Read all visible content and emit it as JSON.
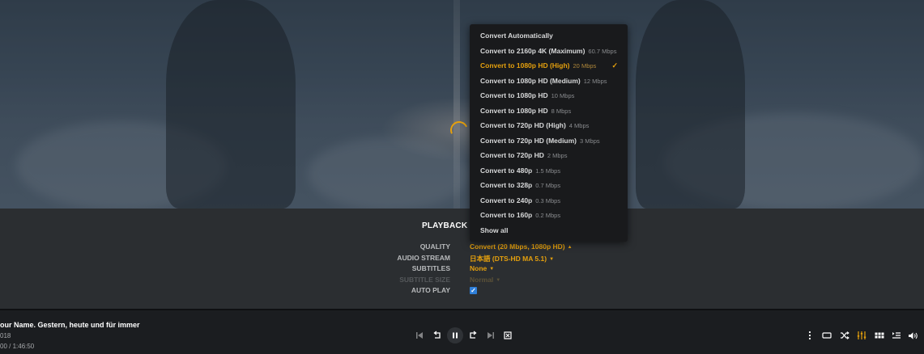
{
  "settings": {
    "title": "PLAYBACK SE",
    "rows": [
      {
        "label": "QUALITY",
        "value": "Convert (20 Mbps, 1080p HD)",
        "caret": "▲"
      },
      {
        "label": "AUDIO STREAM",
        "value": "日本語 (DTS-HD MA 5.1)",
        "caret": "▼"
      },
      {
        "label": "SUBTITLES",
        "value": "None",
        "caret": "▼"
      },
      {
        "label": "SUBTITLE SIZE",
        "value": "Normal",
        "caret": "▼",
        "disabled": true
      },
      {
        "label": "AUTO PLAY",
        "checked": true
      }
    ]
  },
  "quality_menu": {
    "items": [
      {
        "label": "Convert Automatically",
        "rate": ""
      },
      {
        "label": "Convert to 2160p 4K (Maximum)",
        "rate": "60.7 Mbps"
      },
      {
        "label": "Convert to 1080p HD (High)",
        "rate": "20 Mbps",
        "selected": true
      },
      {
        "label": "Convert to 1080p HD (Medium)",
        "rate": "12 Mbps"
      },
      {
        "label": "Convert to 1080p HD",
        "rate": "10 Mbps"
      },
      {
        "label": "Convert to 1080p HD",
        "rate": "8 Mbps"
      },
      {
        "label": "Convert to 720p HD (High)",
        "rate": "4 Mbps"
      },
      {
        "label": "Convert to 720p HD (Medium)",
        "rate": "3 Mbps"
      },
      {
        "label": "Convert to 720p HD",
        "rate": "2 Mbps"
      },
      {
        "label": "Convert to 480p",
        "rate": "1.5 Mbps"
      },
      {
        "label": "Convert to 328p",
        "rate": "0.7 Mbps"
      },
      {
        "label": "Convert to 240p",
        "rate": "0.3 Mbps"
      },
      {
        "label": "Convert to 160p",
        "rate": "0.2 Mbps"
      },
      {
        "label": "Show all",
        "rate": ""
      }
    ],
    "check_glyph": "✓"
  },
  "now_playing": {
    "title": "our Name. Gestern, heute und für immer",
    "year": "018",
    "time": "00 / 1:46:50"
  },
  "colors": {
    "accent": "#e5a00d",
    "checkbox": "#2f7fd8"
  },
  "controls": {
    "center": [
      "skip-back-icon",
      "replay-icon",
      "pause-icon",
      "forward-icon",
      "skip-forward-icon",
      "stop-icon"
    ],
    "right": [
      "more-vertical-icon",
      "repeat-icon",
      "shuffle-icon",
      "equalizer-icon",
      "grid-icon",
      "playlist-icon",
      "volume-icon"
    ]
  }
}
